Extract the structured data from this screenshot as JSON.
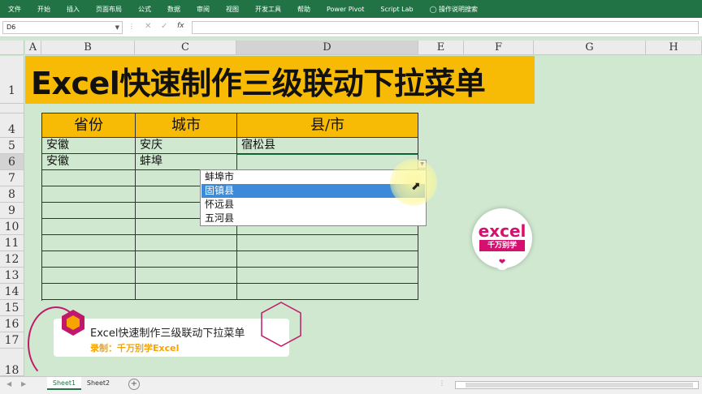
{
  "ribbon": {
    "tabs": [
      "文件",
      "开始",
      "插入",
      "页面布局",
      "公式",
      "数据",
      "审阅",
      "视图",
      "开发工具",
      "帮助",
      "Power Pivot",
      "Script Lab"
    ],
    "tell_me": "操作说明搜索",
    "color": "#217346"
  },
  "formula_bar": {
    "name_box": "D6",
    "formula": "",
    "fx_label": "fx"
  },
  "columns": [
    "A",
    "B",
    "C",
    "D",
    "E",
    "F",
    "G",
    "H"
  ],
  "rows": [
    "1",
    "4",
    "5",
    "6",
    "7",
    "8",
    "9",
    "10",
    "11",
    "12",
    "13",
    "14",
    "15",
    "16",
    "17",
    "18"
  ],
  "banner": {
    "title": "Excel快速制作三级联动下拉菜单",
    "color": "#f7bb06"
  },
  "table": {
    "headers": [
      "省份",
      "城市",
      "县/市"
    ],
    "rows": [
      [
        "安徽",
        "安庆",
        "宿松县"
      ],
      [
        "安徽",
        "蚌埠",
        ""
      ]
    ]
  },
  "dropdown": {
    "items": [
      "蚌埠市",
      "固镇县",
      "怀远县",
      "五河县"
    ],
    "highlighted_index": 1,
    "highlight_color": "#3c8ad8"
  },
  "logo": {
    "brand": "excel",
    "tagline": "千万别学"
  },
  "overlay": {
    "title": "Excel快速制作三级联动下拉菜单",
    "subtitle": "录制：千万别学Excel",
    "accent": "#c2186b"
  },
  "sheet_bar": {
    "tabs": [
      "Sheet1",
      "Sheet2"
    ],
    "active_index": 0
  }
}
